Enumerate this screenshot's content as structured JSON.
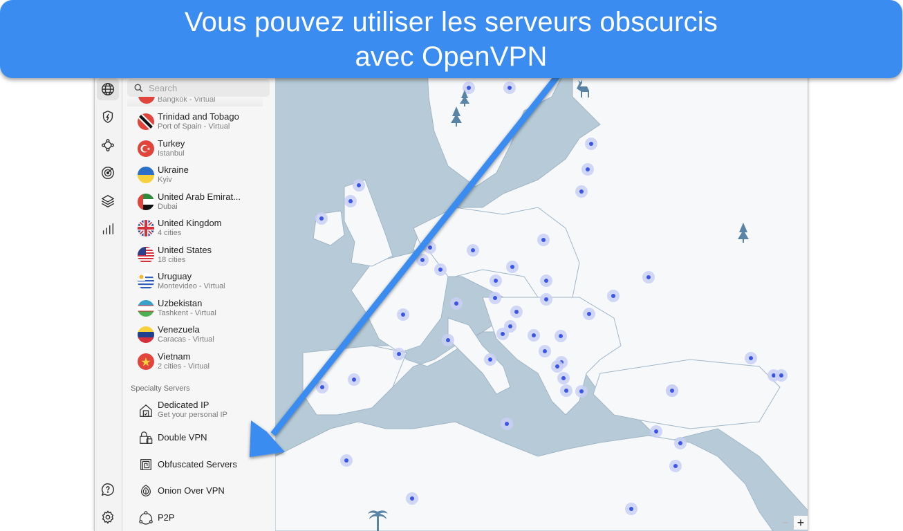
{
  "banner": {
    "line1": "Vous pouvez utiliser les serveurs obscurcis",
    "line2": "avec OpenVPN",
    "color": "#3a8cf0"
  },
  "rail": {
    "top_items": [
      {
        "icon": "globe-icon",
        "label": "Countries",
        "active": true
      },
      {
        "icon": "shield-bolt-icon",
        "label": "Threat Protection"
      },
      {
        "icon": "meshnet-icon",
        "label": "Meshnet"
      },
      {
        "icon": "target-icon",
        "label": "Dark Web Monitor"
      },
      {
        "icon": "layers-icon",
        "label": "Split tunneling"
      },
      {
        "icon": "stats-icon",
        "label": "Statistics"
      }
    ],
    "bottom_items": [
      {
        "icon": "help-icon",
        "label": "Help"
      },
      {
        "icon": "gear-icon",
        "label": "Settings"
      }
    ]
  },
  "search": {
    "placeholder": "Search",
    "value": ""
  },
  "partial_row": {
    "sub": "Bangkok - Virtual"
  },
  "countries": [
    {
      "name": "Trinidad and Tobago",
      "sub": "Port of Spain - Virtual",
      "flag": "tt"
    },
    {
      "name": "Turkey",
      "sub": "Istanbul",
      "flag": "tr"
    },
    {
      "name": "Ukraine",
      "sub": "Kyiv",
      "flag": "ua"
    },
    {
      "name": "United Arab Emirat...",
      "sub": "Dubai",
      "flag": "ae"
    },
    {
      "name": "United Kingdom",
      "sub": "4 cities",
      "flag": "gb"
    },
    {
      "name": "United States",
      "sub": "18 cities",
      "flag": "us"
    },
    {
      "name": "Uruguay",
      "sub": "Montevideo - Virtual",
      "flag": "uy"
    },
    {
      "name": "Uzbekistan",
      "sub": "Tashkent - Virtual",
      "flag": "uz"
    },
    {
      "name": "Venezuela",
      "sub": "Caracas - Virtual",
      "flag": "ve"
    },
    {
      "name": "Vietnam",
      "sub": "2 cities - Virtual",
      "flag": "vn"
    }
  ],
  "specialty": {
    "title": "Specialty Servers",
    "items": [
      {
        "name": "Dedicated IP",
        "sub": "Get your personal IP",
        "icon": "house-icon"
      },
      {
        "name": "Double VPN",
        "sub": "",
        "icon": "double-lock-icon"
      },
      {
        "name": "Obfuscated Servers",
        "sub": "",
        "icon": "obfuscated-icon"
      },
      {
        "name": "Onion Over VPN",
        "sub": "",
        "icon": "onion-icon"
      },
      {
        "name": "P2P",
        "sub": "",
        "icon": "p2p-icon"
      }
    ]
  },
  "map": {
    "zoom_out": "−",
    "zoom_in": "+",
    "land_color": "#f7f8fa",
    "water_color": "#b6cbd7",
    "server_color": "#3b55e6"
  },
  "annotation": {
    "arrow_color": "#3a8cf0",
    "points_to": "Obfuscated Servers"
  }
}
